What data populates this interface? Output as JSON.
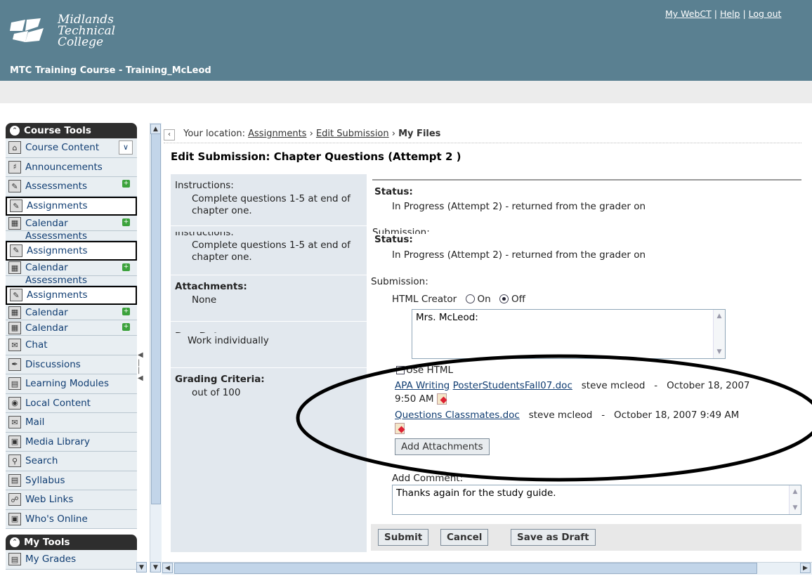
{
  "header": {
    "logo_lines": [
      "Midlands",
      "Technical",
      "College"
    ],
    "top_links": [
      "My WebCT",
      "Help",
      "Log out"
    ],
    "course_title": "MTC Training Course - Training_McLeod"
  },
  "sidebar": {
    "course_tools_label": "Course Tools",
    "my_tools_label": "My Tools",
    "items": [
      {
        "label": "Course Content",
        "icon": "home-icon"
      },
      {
        "label": "Announcements",
        "icon": "megaphone-icon"
      },
      {
        "label": "Assessments",
        "icon": "assessment-icon"
      },
      {
        "label": "Assignments",
        "icon": "assignment-icon"
      },
      {
        "label": "Calendar",
        "icon": "calendar-icon"
      },
      {
        "label": "Assessments",
        "icon": "assessment-icon"
      },
      {
        "label": "Assignments",
        "icon": "assignment-icon"
      },
      {
        "label": "Calendar",
        "icon": "calendar-icon"
      },
      {
        "label": "Assessments",
        "icon": "assessment-icon"
      },
      {
        "label": "Assignments",
        "icon": "assignment-icon"
      },
      {
        "label": "Calendar",
        "icon": "calendar-icon"
      },
      {
        "label": "Calendar",
        "icon": "calendar-icon"
      },
      {
        "label": "Chat",
        "icon": "chat-icon"
      },
      {
        "label": "Discussions",
        "icon": "discussion-icon"
      },
      {
        "label": "Learning Modules",
        "icon": "module-icon"
      },
      {
        "label": "Local Content",
        "icon": "local-content-icon"
      },
      {
        "label": "Mail",
        "icon": "mail-icon"
      },
      {
        "label": "Media Library",
        "icon": "media-icon"
      },
      {
        "label": "Search",
        "icon": "search-icon"
      },
      {
        "label": "Syllabus",
        "icon": "syllabus-icon"
      },
      {
        "label": "Web Links",
        "icon": "weblinks-icon"
      },
      {
        "label": "Who's Online",
        "icon": "online-icon"
      }
    ],
    "my_grades_label": "My Grades"
  },
  "breadcrumb": {
    "prefix": "Your location:",
    "crumbs": [
      "Assignments",
      "Edit Submission"
    ],
    "current": "My Files"
  },
  "page_title": "Edit Submission: Chapter Questions (Attempt 2 )",
  "left_col": {
    "instructions_label": "Instructions:",
    "instructions_text": "Complete questions 1-5 at end of chapter one.",
    "attachments_label": "Attachments:",
    "attachments_value": "None",
    "due_garbled": "Due Date:",
    "type_value": "Work individually",
    "grading_label": "Grading Criteria:",
    "grading_value": "out of 100"
  },
  "right_col": {
    "status_label": "Status:",
    "status_text": "In Progress (Attempt 2) - returned from the grader on",
    "submission_label": "Submission:",
    "html_creator_label": "HTML Creator",
    "radio_on": "On",
    "radio_off": "Off",
    "submission_text": "Mrs. McLeod:",
    "use_html_label": "Use HTML",
    "files": [
      {
        "name_part1": "APA Writing",
        "name_part2": "PosterStudentsFall07.doc",
        "author": "steve mcleod",
        "date_line1": "October 18, 2007",
        "date_line2": "9:50 AM"
      },
      {
        "name": "Questions Classmates.doc",
        "author": "steve mcleod",
        "date": "October 18, 2007 9:49 AM"
      }
    ],
    "add_attachments_label": "Add Attachments",
    "add_comment_label": "Add Comment:",
    "comment_text": "Thanks again for the study guide."
  },
  "buttons": {
    "submit": "Submit",
    "cancel": "Cancel",
    "save_draft": "Save as Draft"
  },
  "colors": {
    "header_bg": "#5a8091",
    "sidebar_bg": "#e8eef2",
    "link": "#103d72"
  }
}
